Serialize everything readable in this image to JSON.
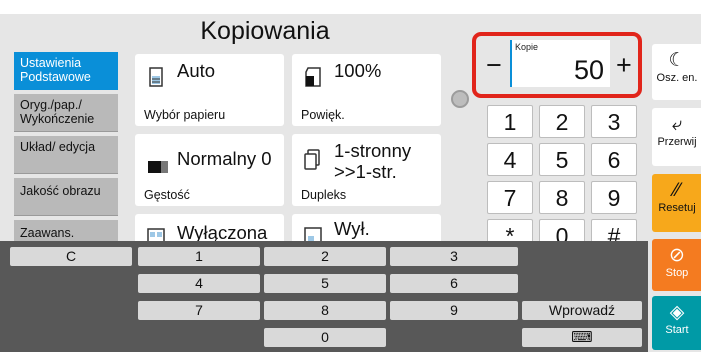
{
  "title": "Kopiowania",
  "tabs": [
    "Ustawienia Podstawowe",
    "Oryg./pap./ Wykończenie",
    "Układ/ edycja",
    "Jakość obrazu",
    "Zaawans."
  ],
  "cards": [
    {
      "value": "Auto",
      "caption": "Wybór papieru",
      "icon": "paper-icon"
    },
    {
      "value": "100%",
      "caption": "Powięk.",
      "icon": "zoom-icon"
    },
    {
      "value": "Normalny 0",
      "caption": "Gęstość",
      "icon": "density-icon"
    },
    {
      "value": "1-stronny >>1-str.",
      "caption": "Dupleks",
      "icon": "duplex-icon"
    },
    {
      "value": "Wyłączona",
      "caption": "",
      "icon": "combine-icon"
    },
    {
      "value": "Wył.",
      "caption": "",
      "icon": "stamp-icon"
    }
  ],
  "copies": {
    "label": "Kopie",
    "value": "50",
    "minus": "−",
    "plus": "+"
  },
  "keypad": [
    "1",
    "2",
    "3",
    "4",
    "5",
    "6",
    "7",
    "8",
    "9",
    "*",
    "0",
    "#"
  ],
  "right_buttons": [
    {
      "label": "Osz. en.",
      "glyph": "☾",
      "icon": "moon-icon"
    },
    {
      "label": "Przerwij",
      "glyph": "⤶",
      "icon": "interrupt-icon"
    },
    {
      "label": "Resetuj",
      "glyph": "⁄⁄",
      "icon": "reset-icon"
    },
    {
      "label": "Stop",
      "glyph": "⊘",
      "icon": "stop-icon"
    },
    {
      "label": "Start",
      "glyph": "◈",
      "icon": "start-icon"
    }
  ],
  "bottom": {
    "clear": "C",
    "keys": [
      "1",
      "2",
      "3",
      "4",
      "5",
      "6",
      "7",
      "8",
      "9",
      "0"
    ],
    "enter": "Wprowadź",
    "keyboard": "⌨"
  },
  "colors": {
    "accent": "#0a8fd8",
    "highlight": "#e1251b",
    "stop": "#f47b20",
    "reset": "#f7a81b",
    "start": "#009aa6"
  }
}
